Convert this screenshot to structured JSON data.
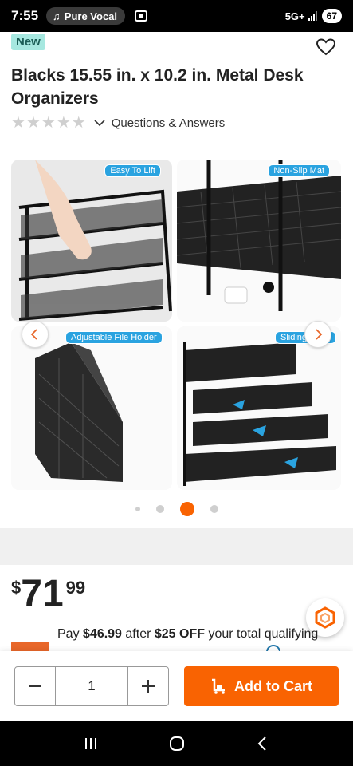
{
  "status_bar": {
    "time": "7:55",
    "media_label": "Pure Vocal",
    "network": "5G+",
    "battery": "67"
  },
  "product": {
    "badge": "New",
    "title": "Blacks 15.55 in. x 10.2 in. Metal Desk Organizers",
    "rating_stars": 0,
    "qa_link": "Questions & Answers"
  },
  "gallery": {
    "tiles": [
      {
        "tag": "Easy To Lift"
      },
      {
        "tag": "Non-Slip Mat"
      },
      {
        "tag": "Adjustable File Holder"
      },
      {
        "tag": "Sliding Mesh"
      }
    ],
    "dots_count": 4,
    "active_dot": 3
  },
  "pricing": {
    "currency": "$",
    "dollars": "71",
    "cents": "99",
    "promo_prefix": "Pay ",
    "promo_amount": "$46.99",
    "promo_mid": " after ",
    "promo_discount": "$25 OFF",
    "promo_suffix": " your total qualifying"
  },
  "cart": {
    "quantity": "1",
    "add_label": "Add to Cart"
  },
  "colors": {
    "accent": "#f96302",
    "badge_bg": "#a6e8e0",
    "tag_bg": "#2aa3e0"
  }
}
